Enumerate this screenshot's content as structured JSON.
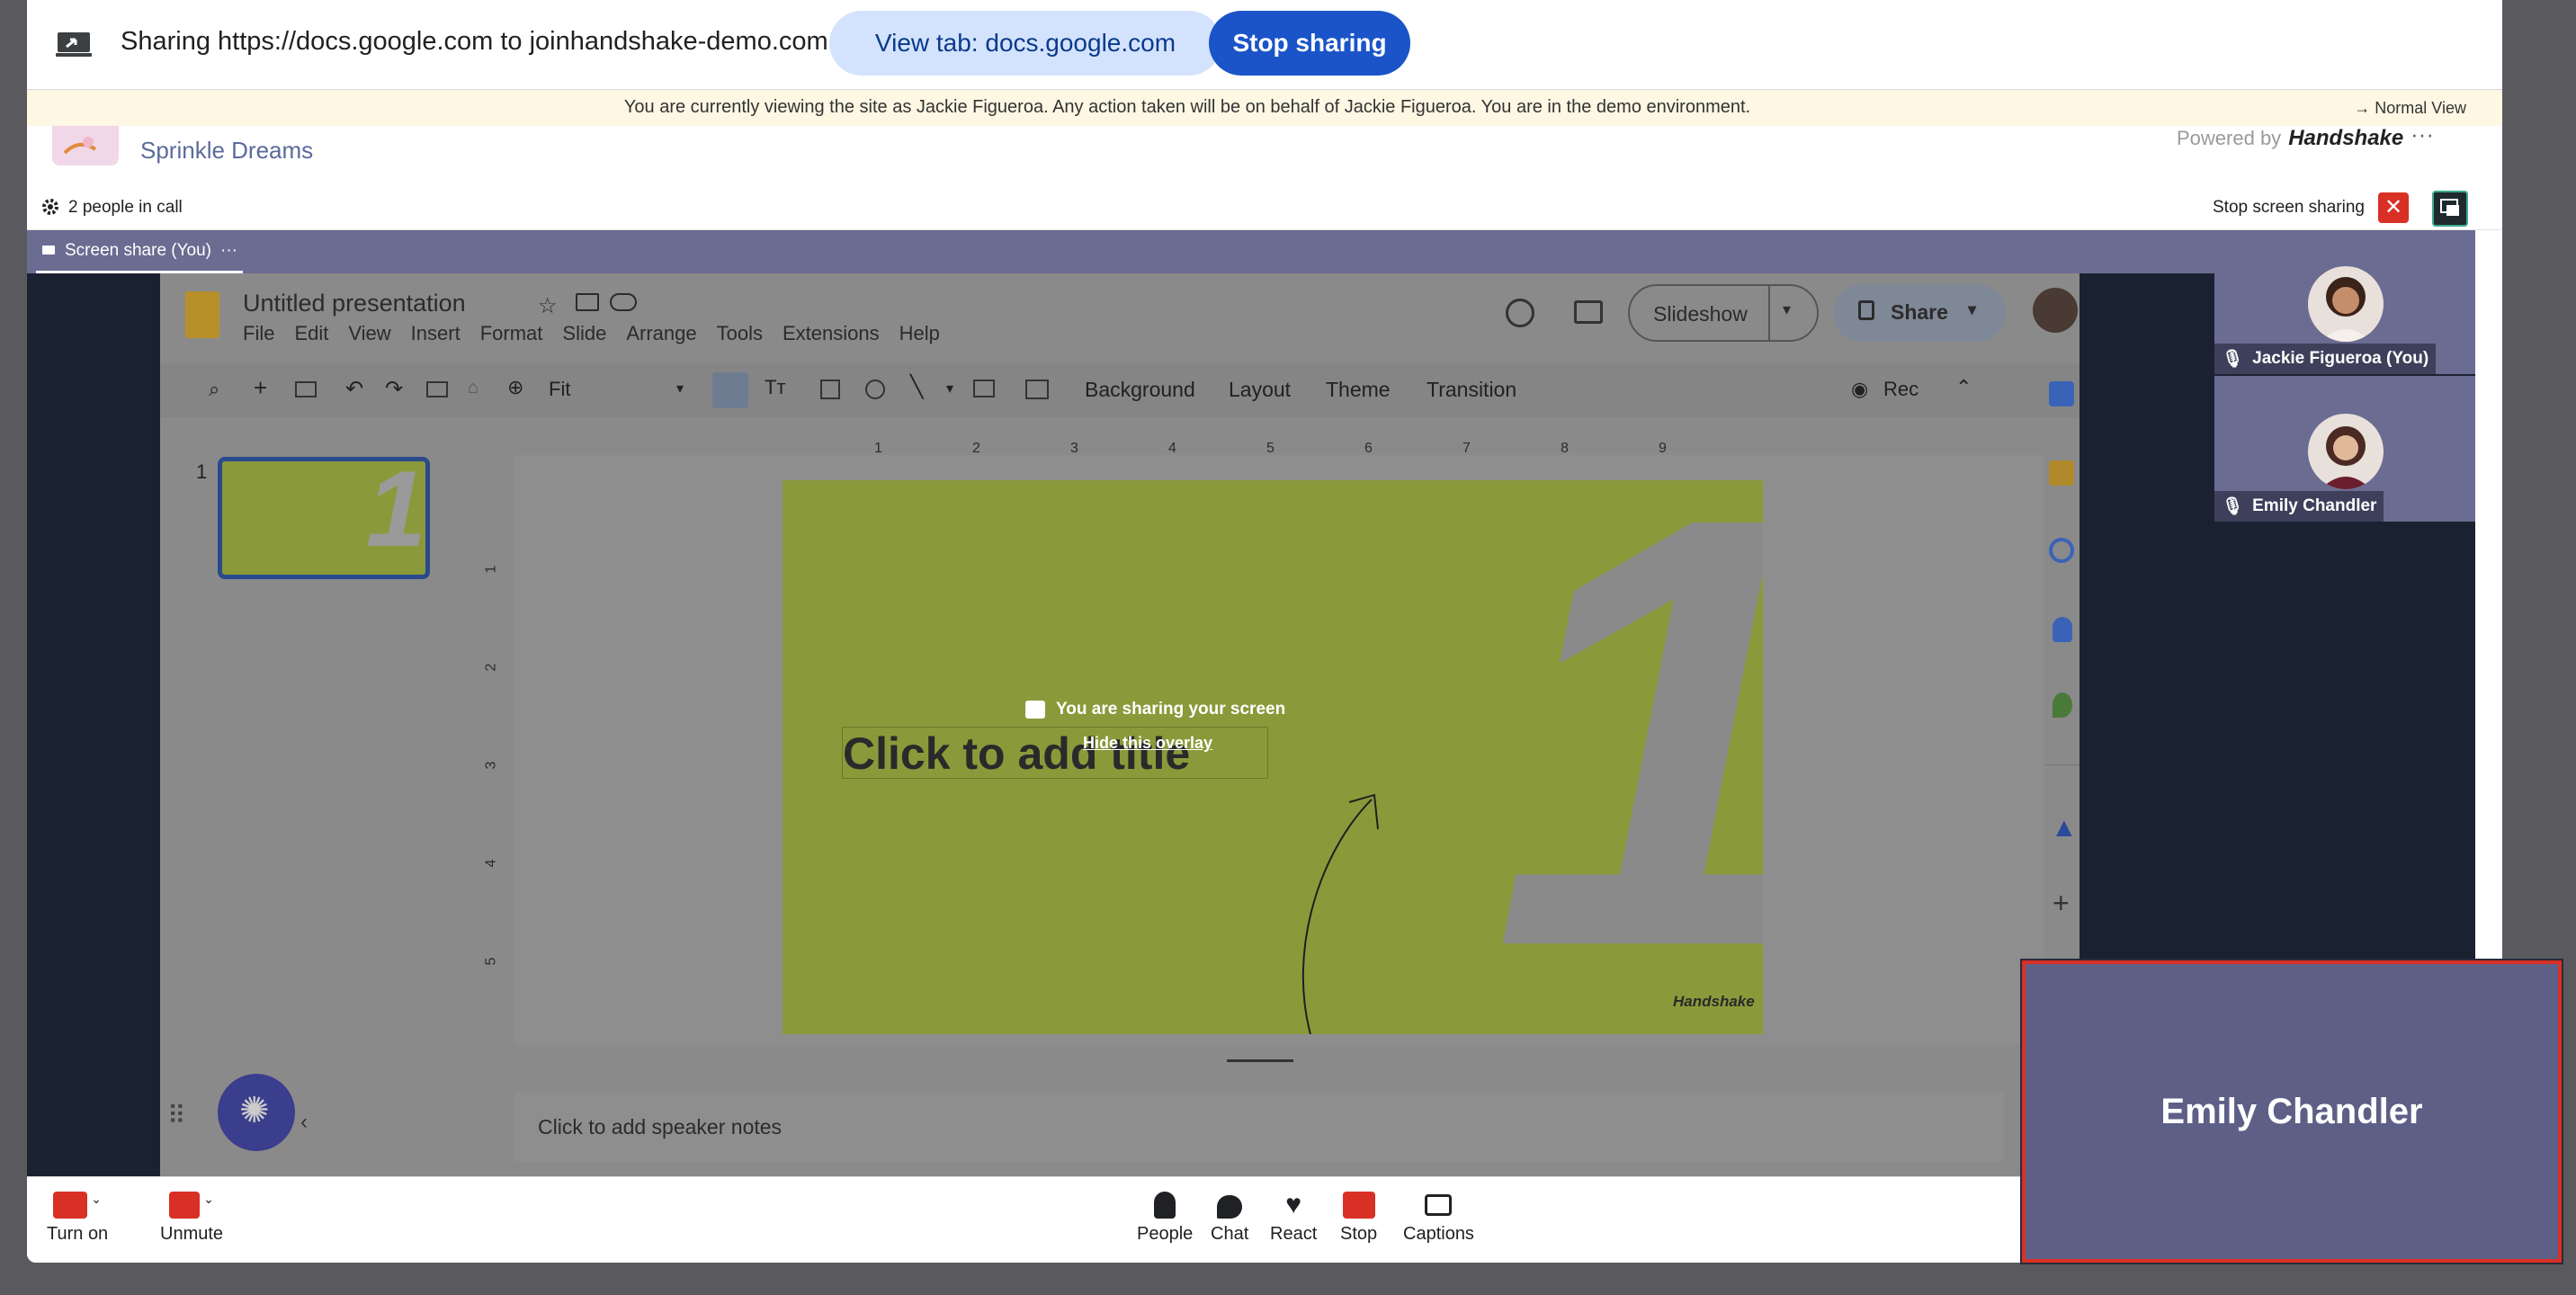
{
  "share_banner": {
    "text": "Sharing https://docs.google.com to joinhandshake-demo.com",
    "view_tab": "View tab: docs.google.com",
    "stop": "Stop sharing"
  },
  "impersonation": {
    "text": "You are currently viewing the site as Jackie Figueroa. Any action taken will be on behalf of Jackie Figueroa. You are in the demo environment.",
    "normal_view": "→ Normal View"
  },
  "app_header": {
    "event_name": "Sprinkle Dreams",
    "powered_by": "Powered by",
    "brand": "Handshake",
    "more": "···"
  },
  "call_bar": {
    "people_count": "2 people in call",
    "stop_screen_sharing": "Stop screen sharing"
  },
  "stage": {
    "tab_label": "Screen share (You)",
    "tab_more": "···"
  },
  "slides": {
    "title": "Untitled presentation",
    "menu": [
      "File",
      "Edit",
      "View",
      "Insert",
      "Format",
      "Slide",
      "Arrange",
      "Tools",
      "Extensions",
      "Help"
    ],
    "slideshow": "Slideshow",
    "share": "Share",
    "zoom": "Fit",
    "toolbar_text": [
      "Background",
      "Layout",
      "Theme",
      "Transition"
    ],
    "rec": "Rec",
    "slide_number": "1",
    "ruler_h": [
      "1",
      "2",
      "3",
      "4",
      "5",
      "6",
      "7",
      "8",
      "9"
    ],
    "ruler_v": [
      "1",
      "2",
      "3",
      "4",
      "5"
    ],
    "slide_title_placeholder": "Click to add title",
    "big_number": "1",
    "watermark": "Handshake",
    "speaker_notes": "Click to add speaker notes",
    "thumb_number": "1",
    "slide_color": "#aebd4a"
  },
  "overlay": {
    "text": "You are sharing your screen",
    "hide": "Hide this overlay"
  },
  "participants": [
    {
      "name": "Jackie Figueroa (You)"
    },
    {
      "name": "Emily Chandler"
    }
  ],
  "controls": {
    "camera": "Turn on",
    "mic": "Unmute",
    "people": "People",
    "chat": "Chat",
    "react": "React",
    "stop": "Stop",
    "captions": "Captions"
  },
  "pip": {
    "name": "Emily Chandler"
  },
  "colors": {
    "accent_blue": "#1a54c8",
    "tile_purple": "#6b6c91",
    "danger_red": "#d93025"
  }
}
